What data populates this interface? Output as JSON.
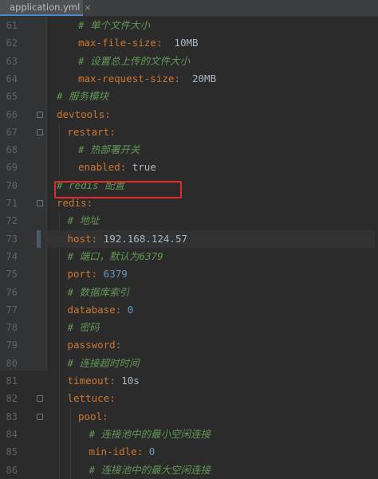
{
  "tab": {
    "label": "application.yml",
    "close": "×"
  },
  "lines": [
    {
      "num": "61",
      "indent": 2,
      "parts": [
        {
          "t": "# 单个文件大小",
          "c": "c"
        }
      ]
    },
    {
      "num": "62",
      "indent": 2,
      "parts": [
        {
          "t": "max-file-size",
          "c": "k"
        },
        {
          "t": ":  ",
          "c": "p"
        },
        {
          "t": "10MB",
          "c": "v"
        }
      ]
    },
    {
      "num": "63",
      "indent": 2,
      "parts": [
        {
          "t": "# 设置总上传的文件大小",
          "c": "c"
        }
      ]
    },
    {
      "num": "64",
      "indent": 2,
      "parts": [
        {
          "t": "max-request-size",
          "c": "k"
        },
        {
          "t": ":  ",
          "c": "p"
        },
        {
          "t": "20MB",
          "c": "v"
        }
      ]
    },
    {
      "num": "65",
      "indent": 0,
      "parts": [
        {
          "t": "# 服务模块",
          "c": "c"
        }
      ]
    },
    {
      "num": "66",
      "indent": 0,
      "parts": [
        {
          "t": "devtools",
          "c": "k"
        },
        {
          "t": ":",
          "c": "p"
        }
      ]
    },
    {
      "num": "67",
      "indent": 1,
      "parts": [
        {
          "t": "restart",
          "c": "k"
        },
        {
          "t": ":",
          "c": "p"
        }
      ]
    },
    {
      "num": "68",
      "indent": 2,
      "parts": [
        {
          "t": "# 热部署开关",
          "c": "c"
        }
      ]
    },
    {
      "num": "69",
      "indent": 2,
      "parts": [
        {
          "t": "enabled",
          "c": "k"
        },
        {
          "t": ": ",
          "c": "p"
        },
        {
          "t": "true",
          "c": "v"
        }
      ]
    },
    {
      "num": "70",
      "indent": 0,
      "parts": [
        {
          "t": "# redis 配置",
          "c": "c"
        }
      ]
    },
    {
      "num": "71",
      "indent": 0,
      "parts": [
        {
          "t": "redis",
          "c": "k"
        },
        {
          "t": ":",
          "c": "p"
        }
      ]
    },
    {
      "num": "72",
      "indent": 1,
      "parts": [
        {
          "t": "# 地址",
          "c": "c"
        }
      ]
    },
    {
      "num": "73",
      "indent": 1,
      "parts": [
        {
          "t": "host",
          "c": "k"
        },
        {
          "t": ": ",
          "c": "p"
        },
        {
          "t": "192.168.124.57",
          "c": "v"
        }
      ]
    },
    {
      "num": "74",
      "indent": 1,
      "parts": [
        {
          "t": "# 端口，默认为6379",
          "c": "c"
        }
      ]
    },
    {
      "num": "75",
      "indent": 1,
      "parts": [
        {
          "t": "port",
          "c": "k"
        },
        {
          "t": ": ",
          "c": "p"
        },
        {
          "t": "6379",
          "c": "n"
        }
      ]
    },
    {
      "num": "76",
      "indent": 1,
      "parts": [
        {
          "t": "# 数据库索引",
          "c": "c"
        }
      ]
    },
    {
      "num": "77",
      "indent": 1,
      "parts": [
        {
          "t": "database",
          "c": "k"
        },
        {
          "t": ": ",
          "c": "p"
        },
        {
          "t": "0",
          "c": "n"
        }
      ]
    },
    {
      "num": "78",
      "indent": 1,
      "parts": [
        {
          "t": "# 密码",
          "c": "c"
        }
      ]
    },
    {
      "num": "79",
      "indent": 1,
      "parts": [
        {
          "t": "password",
          "c": "k"
        },
        {
          "t": ":",
          "c": "p"
        }
      ]
    },
    {
      "num": "80",
      "indent": 1,
      "parts": [
        {
          "t": "# 连接超时时间",
          "c": "c"
        }
      ]
    },
    {
      "num": "81",
      "indent": 1,
      "parts": [
        {
          "t": "timeout",
          "c": "k"
        },
        {
          "t": ": ",
          "c": "p"
        },
        {
          "t": "10s",
          "c": "v"
        }
      ]
    },
    {
      "num": "82",
      "indent": 1,
      "parts": [
        {
          "t": "lettuce",
          "c": "k"
        },
        {
          "t": ":",
          "c": "p"
        }
      ]
    },
    {
      "num": "83",
      "indent": 2,
      "parts": [
        {
          "t": "pool",
          "c": "k"
        },
        {
          "t": ":",
          "c": "p"
        }
      ]
    },
    {
      "num": "84",
      "indent": 3,
      "parts": [
        {
          "t": "# 连接池中的最小空闲连接",
          "c": "c"
        }
      ]
    },
    {
      "num": "85",
      "indent": 3,
      "parts": [
        {
          "t": "min-idle",
          "c": "k"
        },
        {
          "t": ": ",
          "c": "p"
        },
        {
          "t": "0",
          "c": "n"
        }
      ]
    },
    {
      "num": "86",
      "indent": 3,
      "parts": [
        {
          "t": "# 连接池中的最大空闲连接",
          "c": "c"
        }
      ]
    }
  ],
  "colors": {
    "background": "#2b2b2b",
    "key": "#cc7832",
    "value": "#a9b7c6",
    "number": "#6897bb",
    "comment": "#629755",
    "highlight_box": "#e5282a"
  }
}
